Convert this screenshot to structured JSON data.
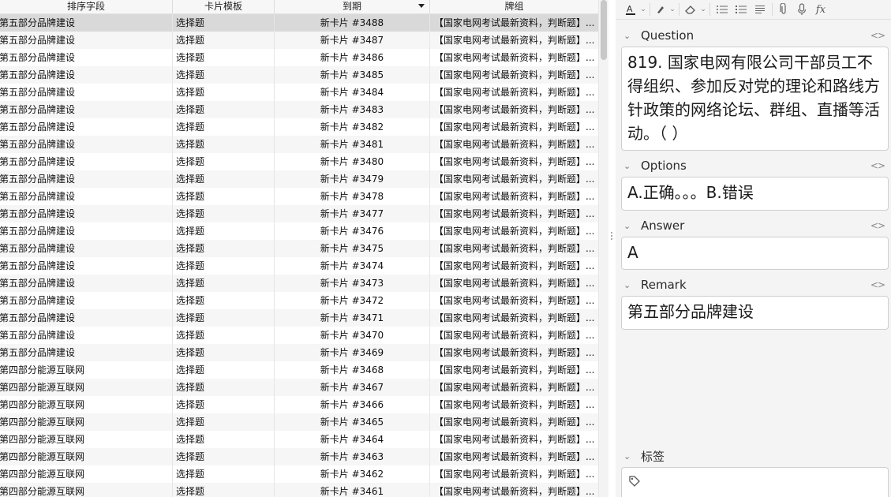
{
  "table": {
    "columns": [
      "排序字段",
      "卡片模板",
      "到期",
      "牌组"
    ],
    "rows": [
      [
        "第五部分品牌建设",
        "选择题",
        "新卡片 #3488",
        "【国家电网考试最新资料，判断题】..."
      ],
      [
        "第五部分品牌建设",
        "选择题",
        "新卡片 #3487",
        "【国家电网考试最新资料，判断题】..."
      ],
      [
        "第五部分品牌建设",
        "选择题",
        "新卡片 #3486",
        "【国家电网考试最新资料，判断题】..."
      ],
      [
        "第五部分品牌建设",
        "选择题",
        "新卡片 #3485",
        "【国家电网考试最新资料，判断题】..."
      ],
      [
        "第五部分品牌建设",
        "选择题",
        "新卡片 #3484",
        "【国家电网考试最新资料，判断题】..."
      ],
      [
        "第五部分品牌建设",
        "选择题",
        "新卡片 #3483",
        "【国家电网考试最新资料，判断题】..."
      ],
      [
        "第五部分品牌建设",
        "选择题",
        "新卡片 #3482",
        "【国家电网考试最新资料，判断题】..."
      ],
      [
        "第五部分品牌建设",
        "选择题",
        "新卡片 #3481",
        "【国家电网考试最新资料，判断题】..."
      ],
      [
        "第五部分品牌建设",
        "选择题",
        "新卡片 #3480",
        "【国家电网考试最新资料，判断题】..."
      ],
      [
        "第五部分品牌建设",
        "选择题",
        "新卡片 #3479",
        "【国家电网考试最新资料，判断题】..."
      ],
      [
        "第五部分品牌建设",
        "选择题",
        "新卡片 #3478",
        "【国家电网考试最新资料，判断题】..."
      ],
      [
        "第五部分品牌建设",
        "选择题",
        "新卡片 #3477",
        "【国家电网考试最新资料，判断题】..."
      ],
      [
        "第五部分品牌建设",
        "选择题",
        "新卡片 #3476",
        "【国家电网考试最新资料，判断题】..."
      ],
      [
        "第五部分品牌建设",
        "选择题",
        "新卡片 #3475",
        "【国家电网考试最新资料，判断题】..."
      ],
      [
        "第五部分品牌建设",
        "选择题",
        "新卡片 #3474",
        "【国家电网考试最新资料，判断题】..."
      ],
      [
        "第五部分品牌建设",
        "选择题",
        "新卡片 #3473",
        "【国家电网考试最新资料，判断题】..."
      ],
      [
        "第五部分品牌建设",
        "选择题",
        "新卡片 #3472",
        "【国家电网考试最新资料，判断题】..."
      ],
      [
        "第五部分品牌建设",
        "选择题",
        "新卡片 #3471",
        "【国家电网考试最新资料，判断题】..."
      ],
      [
        "第五部分品牌建设",
        "选择题",
        "新卡片 #3470",
        "【国家电网考试最新资料，判断题】..."
      ],
      [
        "第五部分品牌建设",
        "选择题",
        "新卡片 #3469",
        "【国家电网考试最新资料，判断题】..."
      ],
      [
        "第四部分能源互联网",
        "选择题",
        "新卡片 #3468",
        "【国家电网考试最新资料，判断题】..."
      ],
      [
        "第四部分能源互联网",
        "选择题",
        "新卡片 #3467",
        "【国家电网考试最新资料，判断题】..."
      ],
      [
        "第四部分能源互联网",
        "选择题",
        "新卡片 #3466",
        "【国家电网考试最新资料，判断题】..."
      ],
      [
        "第四部分能源互联网",
        "选择题",
        "新卡片 #3465",
        "【国家电网考试最新资料，判断题】..."
      ],
      [
        "第四部分能源互联网",
        "选择题",
        "新卡片 #3464",
        "【国家电网考试最新资料，判断题】..."
      ],
      [
        "第四部分能源互联网",
        "选择题",
        "新卡片 #3463",
        "【国家电网考试最新资料，判断题】..."
      ],
      [
        "第四部分能源互联网",
        "选择题",
        "新卡片 #3462",
        "【国家电网考试最新资料，判断题】..."
      ],
      [
        "第四部分能源互联网",
        "选择题",
        "新卡片 #3461",
        "【国家电网考试最新资料，判断题】..."
      ]
    ],
    "selected_row": 0,
    "sort_column": 2
  },
  "toolbar": {
    "icons": [
      "text-color-icon",
      "highlight-icon",
      "eraser-icon",
      "bullet-list-icon",
      "numbered-list-icon",
      "align-icon",
      "attachment-icon",
      "microphone-icon",
      "formula-icon"
    ],
    "formula_label": "fx"
  },
  "editor": {
    "fields": [
      {
        "label": "Question",
        "value": "819. 国家电网有限公司干部员工不得组织、参加反对党的理论和路线方针政策的网络论坛、群组、直播等活动。（ ）"
      },
      {
        "label": "Options",
        "value": "A.正确。。。B.错误"
      },
      {
        "label": "Answer",
        "value": "A"
      },
      {
        "label": "Remark",
        "value": "第五部分品牌建设"
      }
    ],
    "tags_label": "标签",
    "code_toggle": "<>"
  },
  "colors": {
    "selected_row": "#d9d9d9",
    "alt_row": "#f6f6f6",
    "editor_bg": "#f4f4f4"
  }
}
